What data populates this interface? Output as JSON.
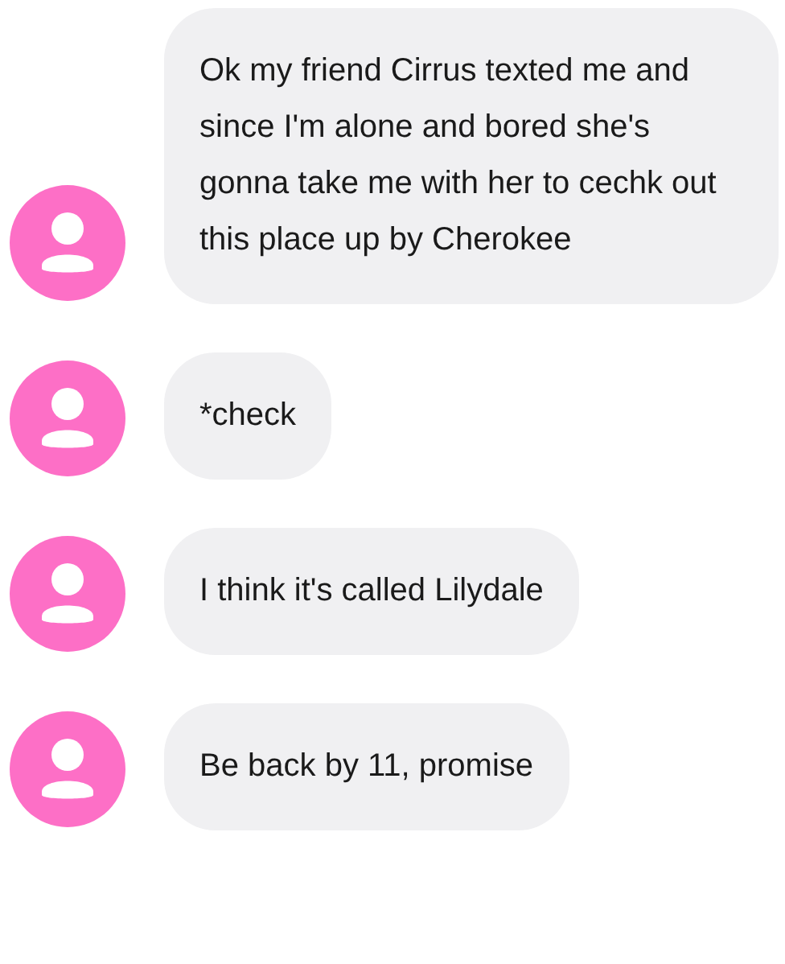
{
  "messages": [
    {
      "text": "Ok my friend Cirrus texted me and since I'm alone and bored she's gonna take me with her to cechk out this place up by Cherokee"
    },
    {
      "text": "*check"
    },
    {
      "text": "I think it's called Lilydale"
    },
    {
      "text": "Be back by 11, promise"
    }
  ]
}
